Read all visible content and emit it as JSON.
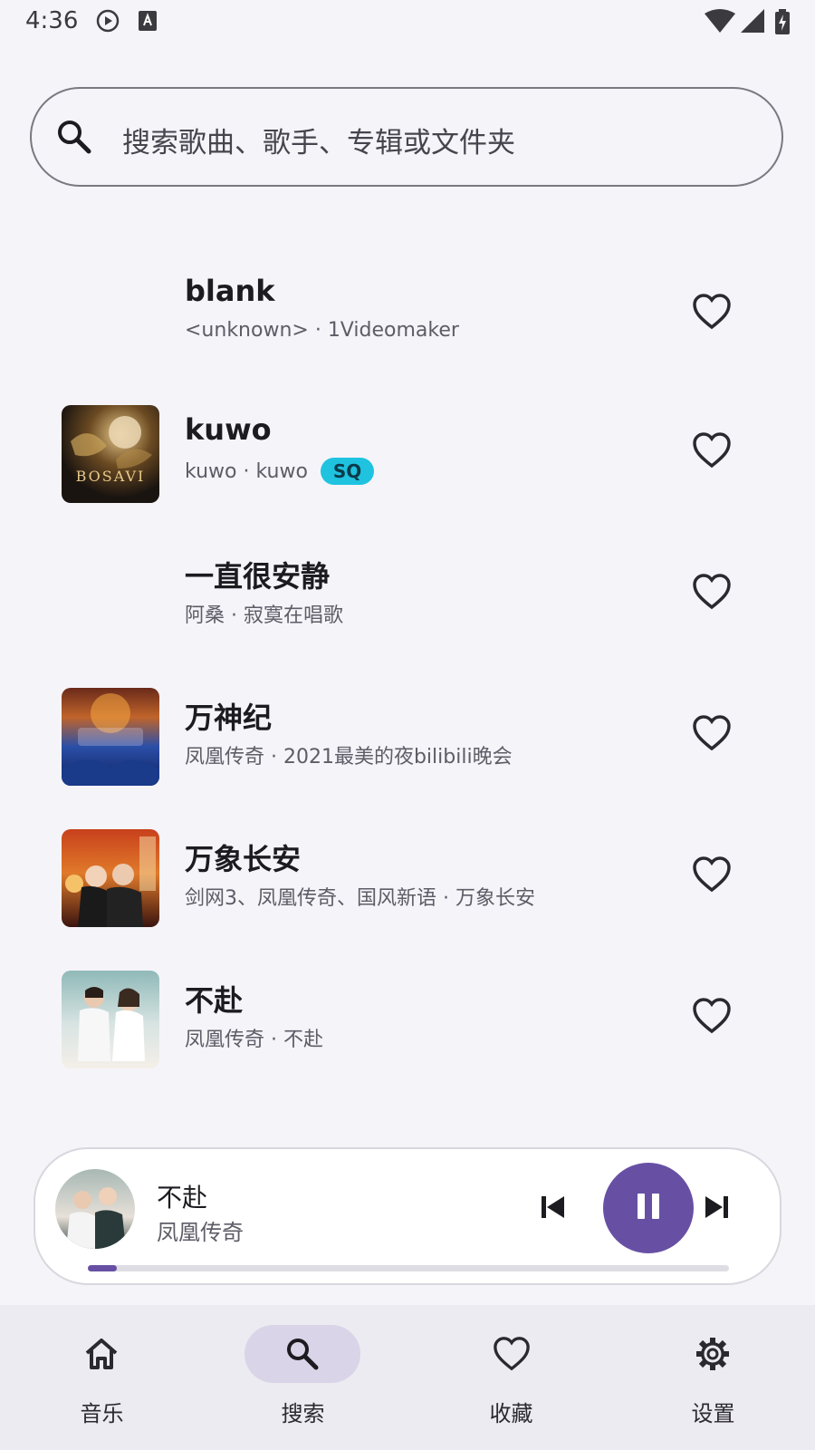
{
  "status": {
    "time": "4:36"
  },
  "search": {
    "placeholder": "搜索歌曲、歌手、专辑或文件夹"
  },
  "songs": [
    {
      "title": "blank",
      "subtitle": "<unknown> · 1Videomaker",
      "badge": ""
    },
    {
      "title": "kuwo",
      "subtitle": "kuwo · kuwo",
      "badge": "SQ",
      "cover_text": "BOSAVI"
    },
    {
      "title": "一直很安静",
      "subtitle": "阿桑 · 寂寞在唱歌",
      "badge": ""
    },
    {
      "title": "万神纪",
      "subtitle": "凤凰传奇 · 2021最美的夜bilibili晚会",
      "badge": ""
    },
    {
      "title": "万象长安",
      "subtitle": "剑网3、凤凰传奇、国风新语 · 万象长安",
      "badge": ""
    },
    {
      "title": "不赴",
      "subtitle": "凤凰传奇 · 不赴",
      "badge": ""
    }
  ],
  "player": {
    "title": "不赴",
    "artist": "凤凰传奇",
    "progress": 0.045
  },
  "nav": [
    {
      "label": "音乐",
      "icon": "home-icon"
    },
    {
      "label": "搜索",
      "icon": "search-icon"
    },
    {
      "label": "收藏",
      "icon": "heart-icon"
    },
    {
      "label": "设置",
      "icon": "gear-icon"
    }
  ],
  "colors": {
    "accent": "#6750a4",
    "badge": "#1fc3e0",
    "background": "#f5f4f9"
  }
}
